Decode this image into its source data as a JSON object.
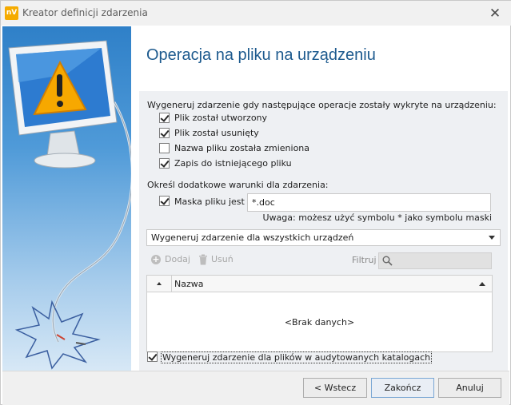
{
  "window": {
    "app_icon": "nV",
    "title": "Kreator definicji zdarzenia",
    "close_glyph": "✕"
  },
  "page_title": "Operacja na pliku na urządzeniu",
  "ops": {
    "heading": "Wygeneruj zdarzenie gdy następujące operacje zostały wykryte na urządzeniu:",
    "items": [
      {
        "label": "Plik został utworzony",
        "checked": true
      },
      {
        "label": "Plik został usunięty",
        "checked": true
      },
      {
        "label": "Nazwa pliku została zmieniona",
        "checked": false
      },
      {
        "label": "Zapis do  istniejącego pliku",
        "checked": true
      }
    ]
  },
  "conditions": {
    "heading": "Określ dodatkowe warunki dla zdarzenia:",
    "mask_label": "Maska pliku jest",
    "mask_checked": true,
    "mask_value": "*.doc",
    "note": "Uwaga: możesz użyć symbolu * jako symbolu maski"
  },
  "device_select": {
    "value": "Wygeneruj zdarzenie dla wszystkich urządzeń"
  },
  "toolbar": {
    "add_label": "Dodaj",
    "remove_label": "Usuń",
    "filter_label": "Filtruj"
  },
  "grid": {
    "column": "Nazwa",
    "empty_text": "<Brak danych>"
  },
  "audited": {
    "label": "Wygeneruj zdarzenie dla plików w audytowanych katalogach",
    "checked": true
  },
  "buttons": {
    "back": "< Wstecz",
    "finish": "Zakończ",
    "cancel": "Anuluj"
  },
  "icons": {
    "app": "app-logo-icon",
    "close": "close-icon",
    "warning": "warning-monitor-icon",
    "add": "add-icon",
    "remove": "trash-icon",
    "search": "search-icon"
  },
  "colors": {
    "title": "#1d5a8e",
    "accent": "#f5ab00",
    "form_bg": "#eef0f3"
  }
}
